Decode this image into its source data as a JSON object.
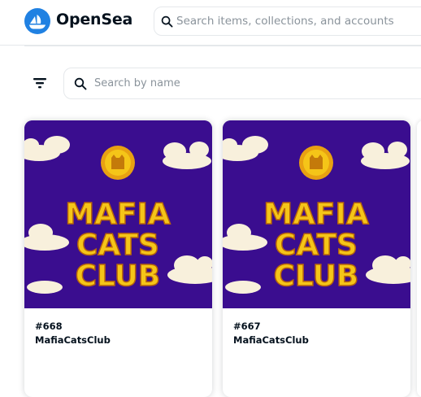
{
  "header": {
    "brand": "OpenSea",
    "search_placeholder": "Search items, collections, and accounts"
  },
  "toolbar": {
    "name_search_placeholder": "Search by name"
  },
  "items": [
    {
      "number": "#668",
      "collection": "MafiaCatsClub",
      "art_text": [
        "MAFIA",
        "CATS",
        "CLUB"
      ]
    },
    {
      "number": "#667",
      "collection": "MafiaCatsClub",
      "art_text": [
        "MAFIA",
        "CATS",
        "CLUB"
      ]
    }
  ],
  "colors": {
    "brand_blue": "#2081e2",
    "art_background": "#3a0d8f",
    "art_lettering": "#f5c518",
    "clouds": "#f8f0dc"
  },
  "icons": [
    "opensea-logo-icon",
    "search-icon",
    "filter-icon",
    "coin-cat-icon"
  ]
}
